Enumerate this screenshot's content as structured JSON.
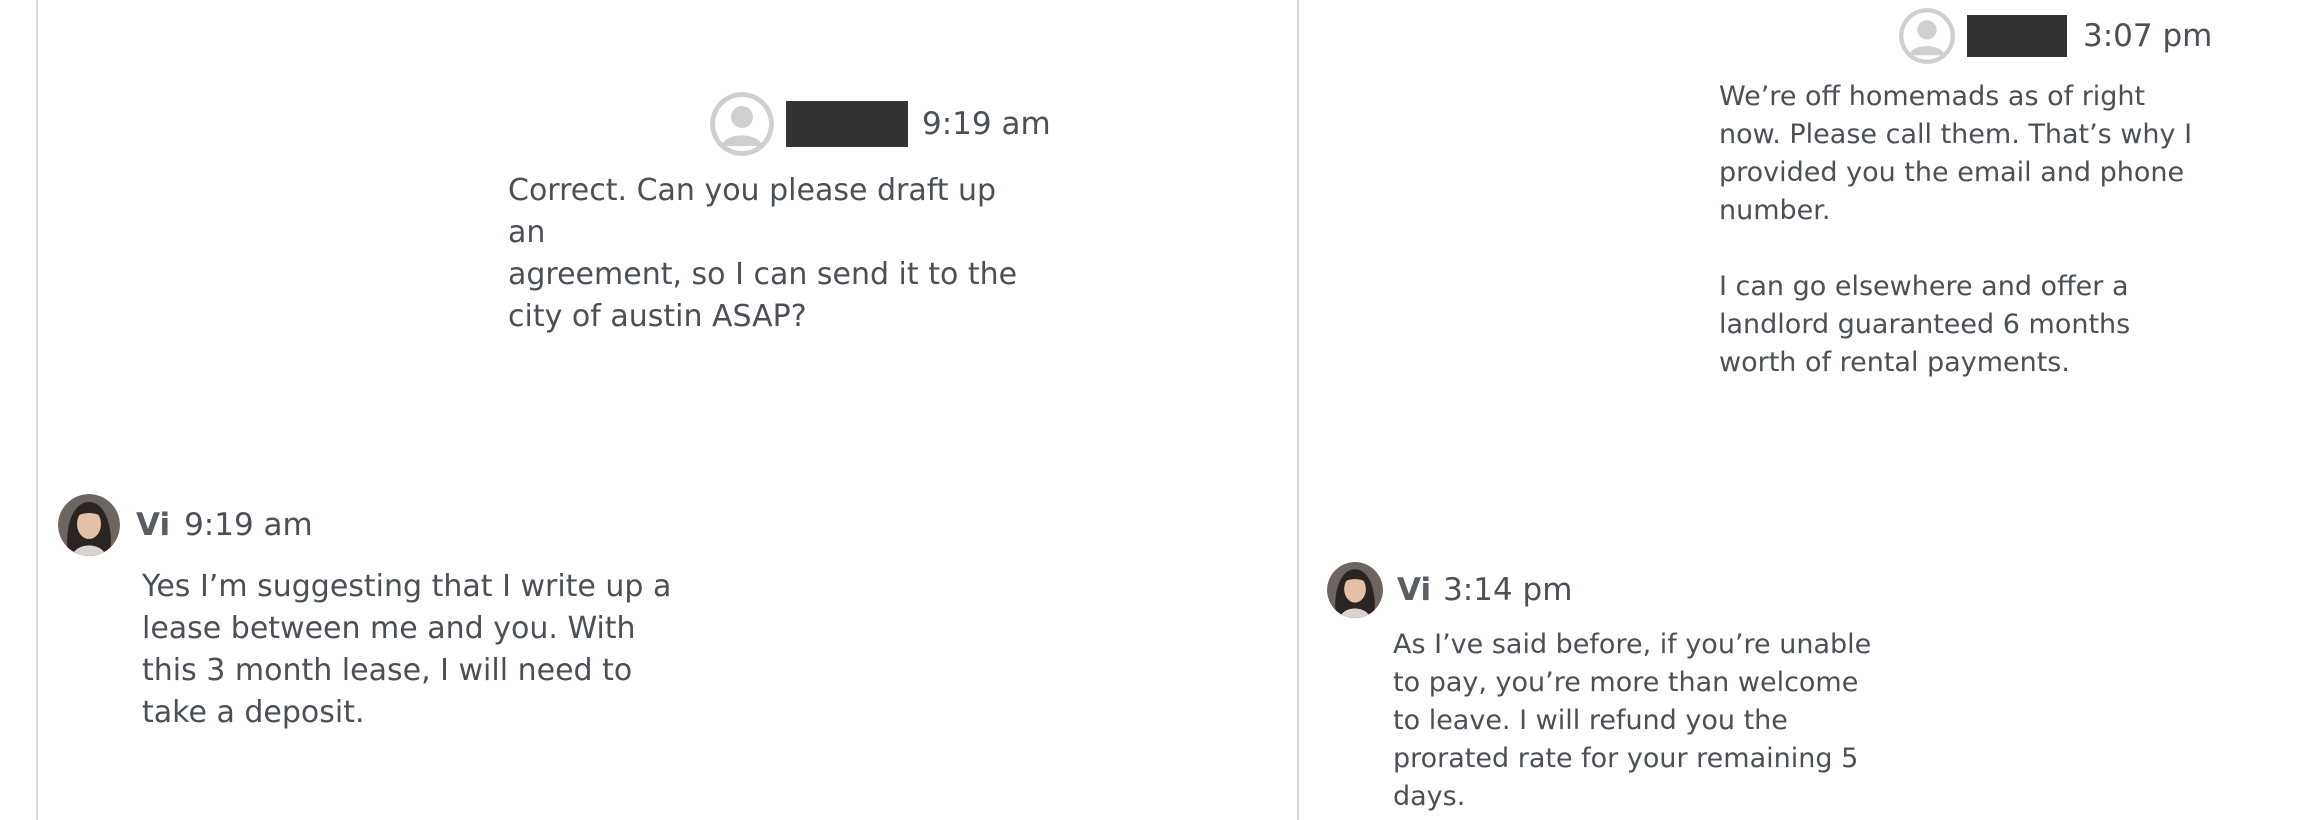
{
  "left_panel": {
    "outgoing": {
      "time": "9:19 am",
      "text": "Correct. Can you please draft up an\nagreement, so I can send it to the\ncity of austin ASAP?"
    },
    "incoming": {
      "sender": "Vi",
      "time": "9:19 am",
      "text": "Yes I’m suggesting that I write up a\nlease between me and you. With\nthis 3 month lease, I will need to\ntake a deposit."
    }
  },
  "right_panel": {
    "outgoing": {
      "time": "3:07 pm",
      "paragraph_1": "We’re off homemads as of right\nnow. Please call them. That’s why I\nprovided you the email and phone\nnumber.",
      "paragraph_2": "I can go elsewhere and offer a\nlandlord guaranteed 6 months\nworth of rental payments."
    },
    "incoming": {
      "sender": "Vi",
      "time": "3:14 pm",
      "text": "As I’ve said before, if you’re unable\nto pay, you’re more than welcome\nto leave. I will refund you the\nprorated rate for your remaining 5\ndays."
    }
  },
  "colors": {
    "text": "#4b4f56",
    "divider": "#d7d9de",
    "redaction": "#333333",
    "placeholder_avatar": "#cccccc"
  },
  "icons": {
    "placeholder_avatar": "default-user-avatar-icon",
    "sender_avatar": "user-photo-avatar"
  }
}
